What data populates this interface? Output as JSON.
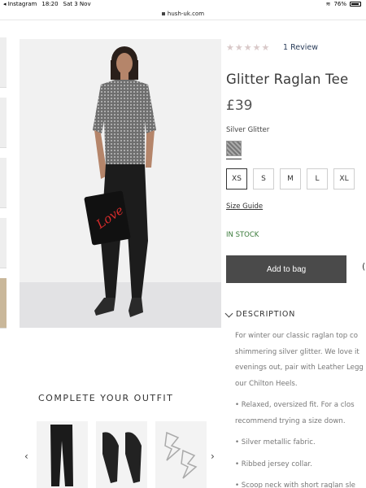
{
  "status_bar": {
    "back_app": "◂ Instagram",
    "time": "18:20",
    "date": "Sat 3 Nov",
    "battery": "76%"
  },
  "url_bar": {
    "domain": "hush-uk.com"
  },
  "product": {
    "stars": "★★★★★",
    "review_link": "1 Review",
    "title": "Glitter Raglan Tee",
    "price": "£39",
    "colour": "Silver Glitter",
    "sizes": [
      "XS",
      "S",
      "M",
      "L",
      "XL"
    ],
    "selected_size": "XS",
    "size_guide": "Size Guide",
    "stock": "IN STOCK",
    "add_to_bag": "Add to bag",
    "extra_action": "("
  },
  "description": {
    "heading": "DESCRIPTION",
    "lines": [
      "For winter our classic raglan top co",
      "shimmering silver glitter. We love it",
      "evenings out, pair with Leather Legg",
      "our Chilton Heels."
    ],
    "bullets": [
      "• Relaxed, oversized fit. For a clos",
      "recommend trying a size down.",
      "• Silver metallic fabric.",
      "• Ribbed jersey collar.",
      "• Scoop neck with short raglan sle"
    ]
  },
  "outfit": {
    "title": "COMPLETE YOUR OUTFIT",
    "prev": "‹",
    "next": "›",
    "items": [
      "trousers",
      "heels",
      "earrings"
    ]
  },
  "colors": {
    "button": "#4a4a4a",
    "stock": "#3a7a3a",
    "stars": "#d9c9c9",
    "link": "#2a3d5a"
  }
}
